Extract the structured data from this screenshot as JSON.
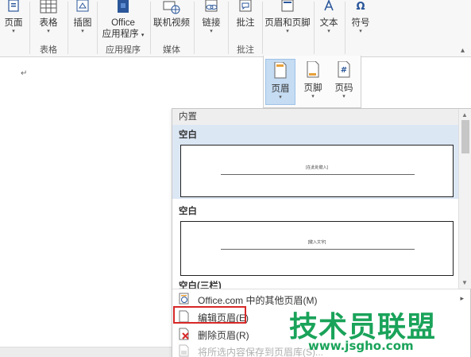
{
  "ribbon": {
    "buttons": {
      "page": "页面",
      "table": "表格",
      "illustrations": "插图",
      "office_line1": "Office",
      "office_line2": "应用程序",
      "online_video": "联机视频",
      "links": "链接",
      "comment": "批注",
      "header_footer": "页眉和页脚",
      "text": "文本",
      "symbols": "符号"
    },
    "groups": {
      "tables": "表格",
      "apps": "应用程序",
      "media": "媒体",
      "comments": "批注"
    },
    "caret": "▾",
    "collapse": "▴"
  },
  "document": {
    "paragraph_mark": "↵"
  },
  "header_footer_gallery": {
    "header": "页眉",
    "footer": "页脚",
    "page_number": "页码",
    "page_number_symbol": "#"
  },
  "header_dropdown": {
    "section_heading": "内置",
    "templates": [
      {
        "name": "空白",
        "placeholder": "[在此处键入]"
      },
      {
        "name": "空白",
        "placeholder": "[键入文字]"
      },
      {
        "name": "空白(三栏)"
      }
    ],
    "menu_items": [
      {
        "label": "Office.com 中的其他页眉(M)",
        "has_submenu": true,
        "enabled": true
      },
      {
        "label": "编辑页眉(E)",
        "has_submenu": false,
        "enabled": true
      },
      {
        "label": "删除页眉(R)",
        "has_submenu": false,
        "enabled": true
      },
      {
        "label": "将所选内容保存到页眉库(S)...",
        "has_submenu": false,
        "enabled": false
      }
    ],
    "submenu_arrow": "▸",
    "scroll_up": "▲",
    "scroll_down": "▼"
  },
  "watermark": {
    "logo_text": "技术员联盟",
    "url": "www.jsgho.com"
  },
  "colors": {
    "accent_blue": "#2b579a",
    "selection": "#dce7f4",
    "highlight_box": "#d62828",
    "watermark_green": "#1aa35a"
  }
}
